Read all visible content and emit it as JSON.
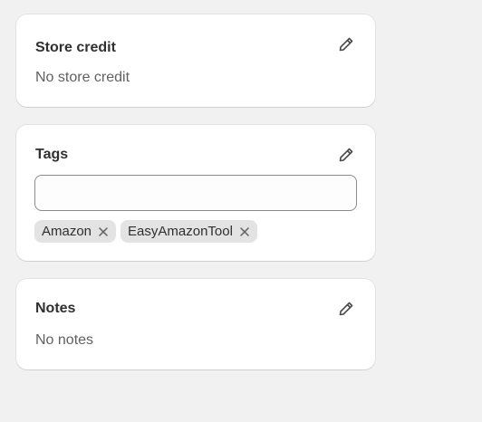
{
  "store_credit": {
    "title": "Store credit",
    "value": "No store credit",
    "edit_icon": "pencil-icon"
  },
  "tags": {
    "title": "Tags",
    "input_value": "",
    "edit_icon": "pencil-icon",
    "items": [
      {
        "label": "Amazon",
        "remove_icon": "x-icon"
      },
      {
        "label": "EasyAmazonTool",
        "remove_icon": "x-icon"
      }
    ]
  },
  "notes": {
    "title": "Notes",
    "value": "No notes",
    "edit_icon": "pencil-icon"
  },
  "colors": {
    "background": "#f1f1f1",
    "card": "#ffffff",
    "tag_bg": "#e3e3e3",
    "icon": "#4a4a4a"
  }
}
